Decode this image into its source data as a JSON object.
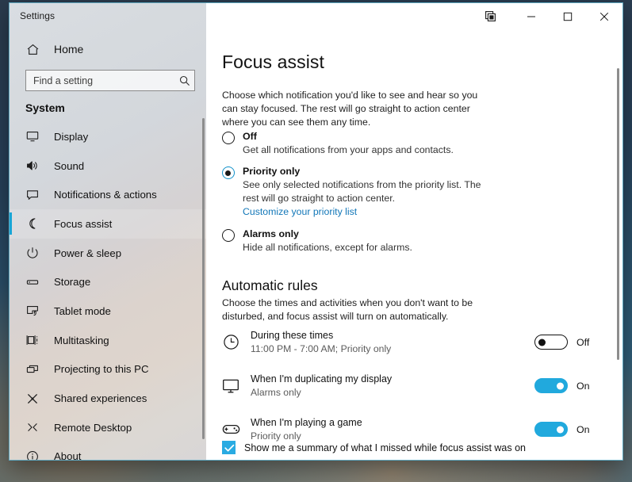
{
  "window": {
    "title": "Settings",
    "buttons": {
      "feedback": "feedback-icon",
      "minimize": "Minimize",
      "maximize": "Maximize",
      "close": "Close"
    }
  },
  "sidebar": {
    "home_label": "Home",
    "search": {
      "placeholder": "Find a setting",
      "value": ""
    },
    "group_title": "System",
    "items": [
      {
        "label": "Display",
        "icon": "monitor-icon",
        "selected": false
      },
      {
        "label": "Sound",
        "icon": "speaker-icon",
        "selected": false
      },
      {
        "label": "Notifications & actions",
        "icon": "notification-icon",
        "selected": false
      },
      {
        "label": "Focus assist",
        "icon": "moon-icon",
        "selected": true
      },
      {
        "label": "Power & sleep",
        "icon": "power-icon",
        "selected": false
      },
      {
        "label": "Storage",
        "icon": "drive-icon",
        "selected": false
      },
      {
        "label": "Tablet mode",
        "icon": "tablet-icon",
        "selected": false
      },
      {
        "label": "Multitasking",
        "icon": "multitasking-icon",
        "selected": false
      },
      {
        "label": "Projecting to this PC",
        "icon": "project-icon",
        "selected": false
      },
      {
        "label": "Shared experiences",
        "icon": "share-icon",
        "selected": false
      },
      {
        "label": "Remote Desktop",
        "icon": "remote-desktop-icon",
        "selected": false
      },
      {
        "label": "About",
        "icon": "info-icon",
        "selected": false
      }
    ]
  },
  "main": {
    "page_title": "Focus assist",
    "intro": "Choose which notification you'd like to see and hear so you can stay focused. The rest will go straight to action center where you can see them any time.",
    "options": [
      {
        "label": "Off",
        "description": "Get all notifications from your apps and contacts.",
        "selected": false,
        "link": null
      },
      {
        "label": "Priority only",
        "description": "See only selected notifications from the priority list. The rest will go straight to action center.",
        "selected": true,
        "link": "Customize your priority list"
      },
      {
        "label": "Alarms only",
        "description": "Hide all notifications, except for alarms.",
        "selected": false,
        "link": null
      }
    ],
    "automatic_rules": {
      "title": "Automatic rules",
      "description": "Choose the times and activities when you don't want to be disturbed, and focus assist will turn on automatically.",
      "rules": [
        {
          "icon": "clock-icon",
          "name": "During these times",
          "sub": "11:00 PM - 7:00 AM; Priority only",
          "state": "Off",
          "on": false
        },
        {
          "icon": "monitor-icon",
          "name": "When I'm duplicating my display",
          "sub": "Alarms only",
          "state": "On",
          "on": true
        },
        {
          "icon": "gamepad-icon",
          "name": "When I'm playing a game",
          "sub": "Priority only",
          "state": "On",
          "on": true
        }
      ]
    },
    "summary_checkbox": {
      "label": "Show me a summary of what I missed while focus assist was on",
      "checked": true
    }
  },
  "colors": {
    "accent": "#21a9dd",
    "selection_bar": "#18a5d6",
    "link": "#1277b8",
    "checkbox": "#29abe2"
  }
}
